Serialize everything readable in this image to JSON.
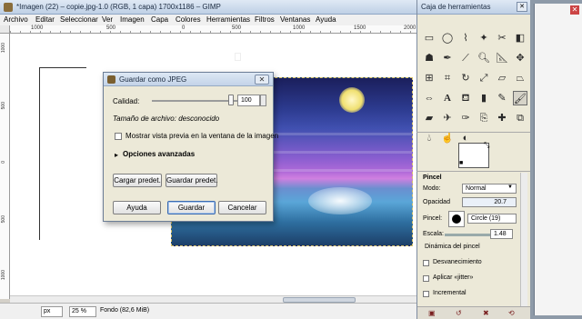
{
  "main_window": {
    "title": "*Imagen (22) – copie.jpg-1.0 (RGB, 1 capa) 1700x1186 – GIMP",
    "menu": [
      "Archivo",
      "Editar",
      "Seleccionar",
      "Ver",
      "Imagen",
      "Capa",
      "Colores",
      "Herramientas",
      "Filtros",
      "Ventanas",
      "Ayuda"
    ],
    "ruler_top": [
      "1000",
      "500",
      "0",
      "500",
      "1000",
      "1500",
      "2000"
    ],
    "ruler_left": [
      "1000",
      "500",
      "0",
      "500",
      "1000"
    ],
    "status": {
      "unit": "px",
      "zoom": "25 %",
      "text": "Fondo (82,6 MiB)"
    }
  },
  "dialog": {
    "title": "Guardar como JPEG",
    "quality_label": "Calidad:",
    "quality_value": "100",
    "quality_fraction": 1.0,
    "filesize_text": "Tamaño de archivo: desconocido",
    "preview_checkbox": "Mostrar vista previa en la ventana de la imagen",
    "advanced_label": "Opciones avanzadas",
    "load_defaults": "Cargar predet.",
    "save_defaults": "Guardar predet.",
    "help": "Ayuda",
    "save": "Guardar",
    "cancel": "Cancelar"
  },
  "toolbox": {
    "title": "Caja de herramientas",
    "tools": [
      "rect-select",
      "ellipse-select",
      "free-select",
      "fuzzy-select",
      "scissors",
      "select-by-color",
      "foreground-select",
      "paths",
      "color-picker",
      "zoom",
      "measure",
      "move",
      "align",
      "crop",
      "rotate",
      "scale",
      "shear",
      "perspective",
      "flip",
      "text",
      "bucket-fill",
      "blend",
      "pencil",
      "paintbrush",
      "eraser",
      "airbrush",
      "ink",
      "clone",
      "heal",
      "perspective-clone",
      "blur",
      "smudge",
      "dodge-burn"
    ],
    "active_tool": "paintbrush",
    "options": {
      "title": "Pincel",
      "mode_label": "Modo:",
      "mode_value": "Normal",
      "opacity_label": "Opacidad",
      "opacity_value": "20.7",
      "brush_label": "Pincel:",
      "brush_value": "Circle (19)",
      "scale_label": "Escala:",
      "scale_value": "1.48",
      "dynamics": "Dinámica del pincel",
      "fade": "Desvanecimiento",
      "jitter": "Aplicar «jitter»",
      "incremental": "Incremental"
    }
  }
}
